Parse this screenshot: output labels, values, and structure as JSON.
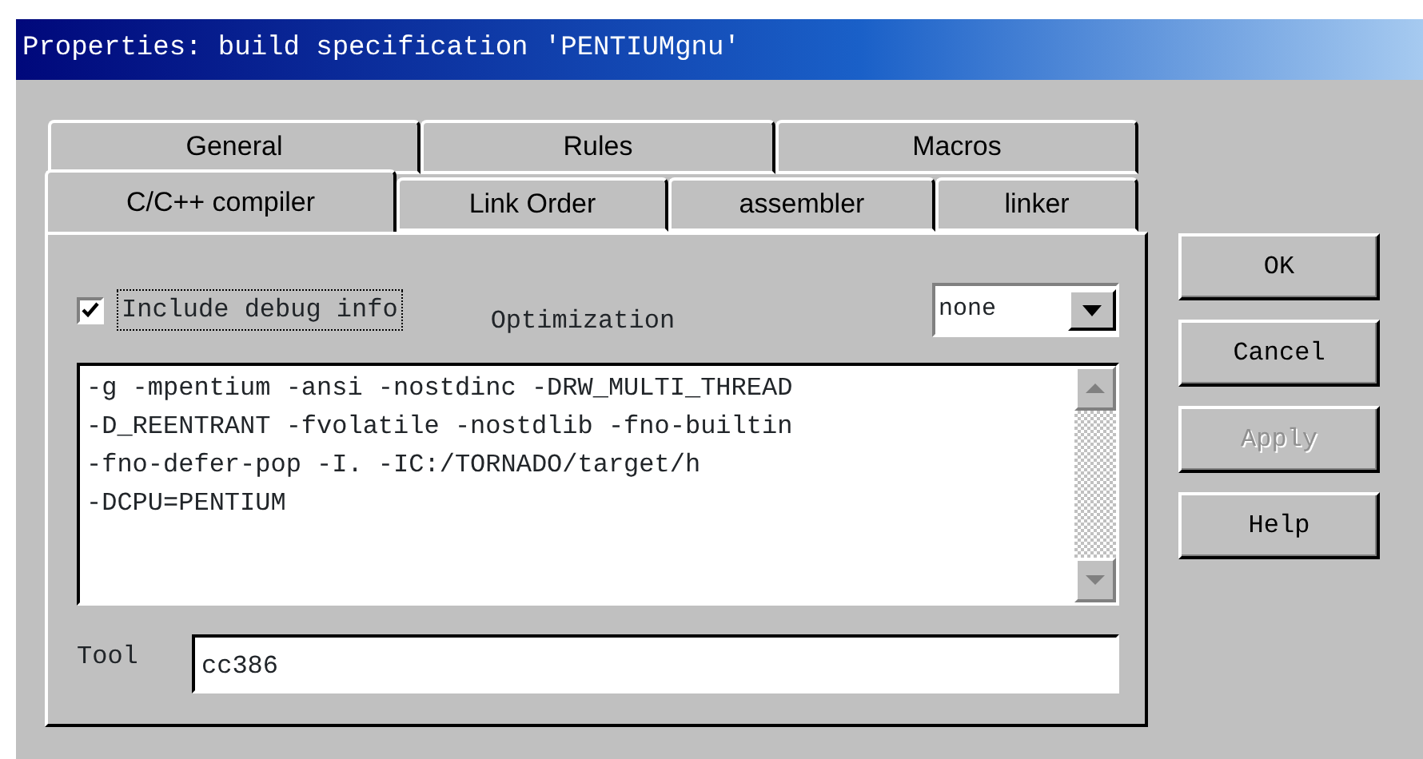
{
  "window": {
    "title": "Properties: build specification 'PENTIUMgnu'"
  },
  "tab_rows": [
    {
      "tabs": [
        {
          "label": "General",
          "selected": false
        },
        {
          "label": "Rules",
          "selected": false
        },
        {
          "label": "Macros",
          "selected": false
        }
      ]
    },
    {
      "tabs": [
        {
          "label": "C/C++ compiler",
          "selected": true
        },
        {
          "label": "Link Order",
          "selected": false
        },
        {
          "label": "assembler",
          "selected": false
        },
        {
          "label": "linker",
          "selected": false
        }
      ]
    }
  ],
  "debug_checkbox": {
    "label": "Include debug info",
    "checked": true
  },
  "optimization": {
    "label": "Optimization",
    "value": "none"
  },
  "flags": {
    "lines": [
      "-g -mpentium -ansi -nostdinc -DRW_MULTI_THREAD",
      "-D_REENTRANT -fvolatile -nostdlib -fno-builtin",
      "-fno-defer-pop -I. -IC:/TORNADO/target/h",
      "-DCPU=PENTIUM"
    ]
  },
  "tool": {
    "label": "Tool",
    "value": "cc386"
  },
  "buttons": [
    {
      "label": "OK",
      "disabled": false
    },
    {
      "label": "Cancel",
      "disabled": false
    },
    {
      "label": "Apply",
      "disabled": true
    },
    {
      "label": "Help",
      "disabled": false
    }
  ]
}
